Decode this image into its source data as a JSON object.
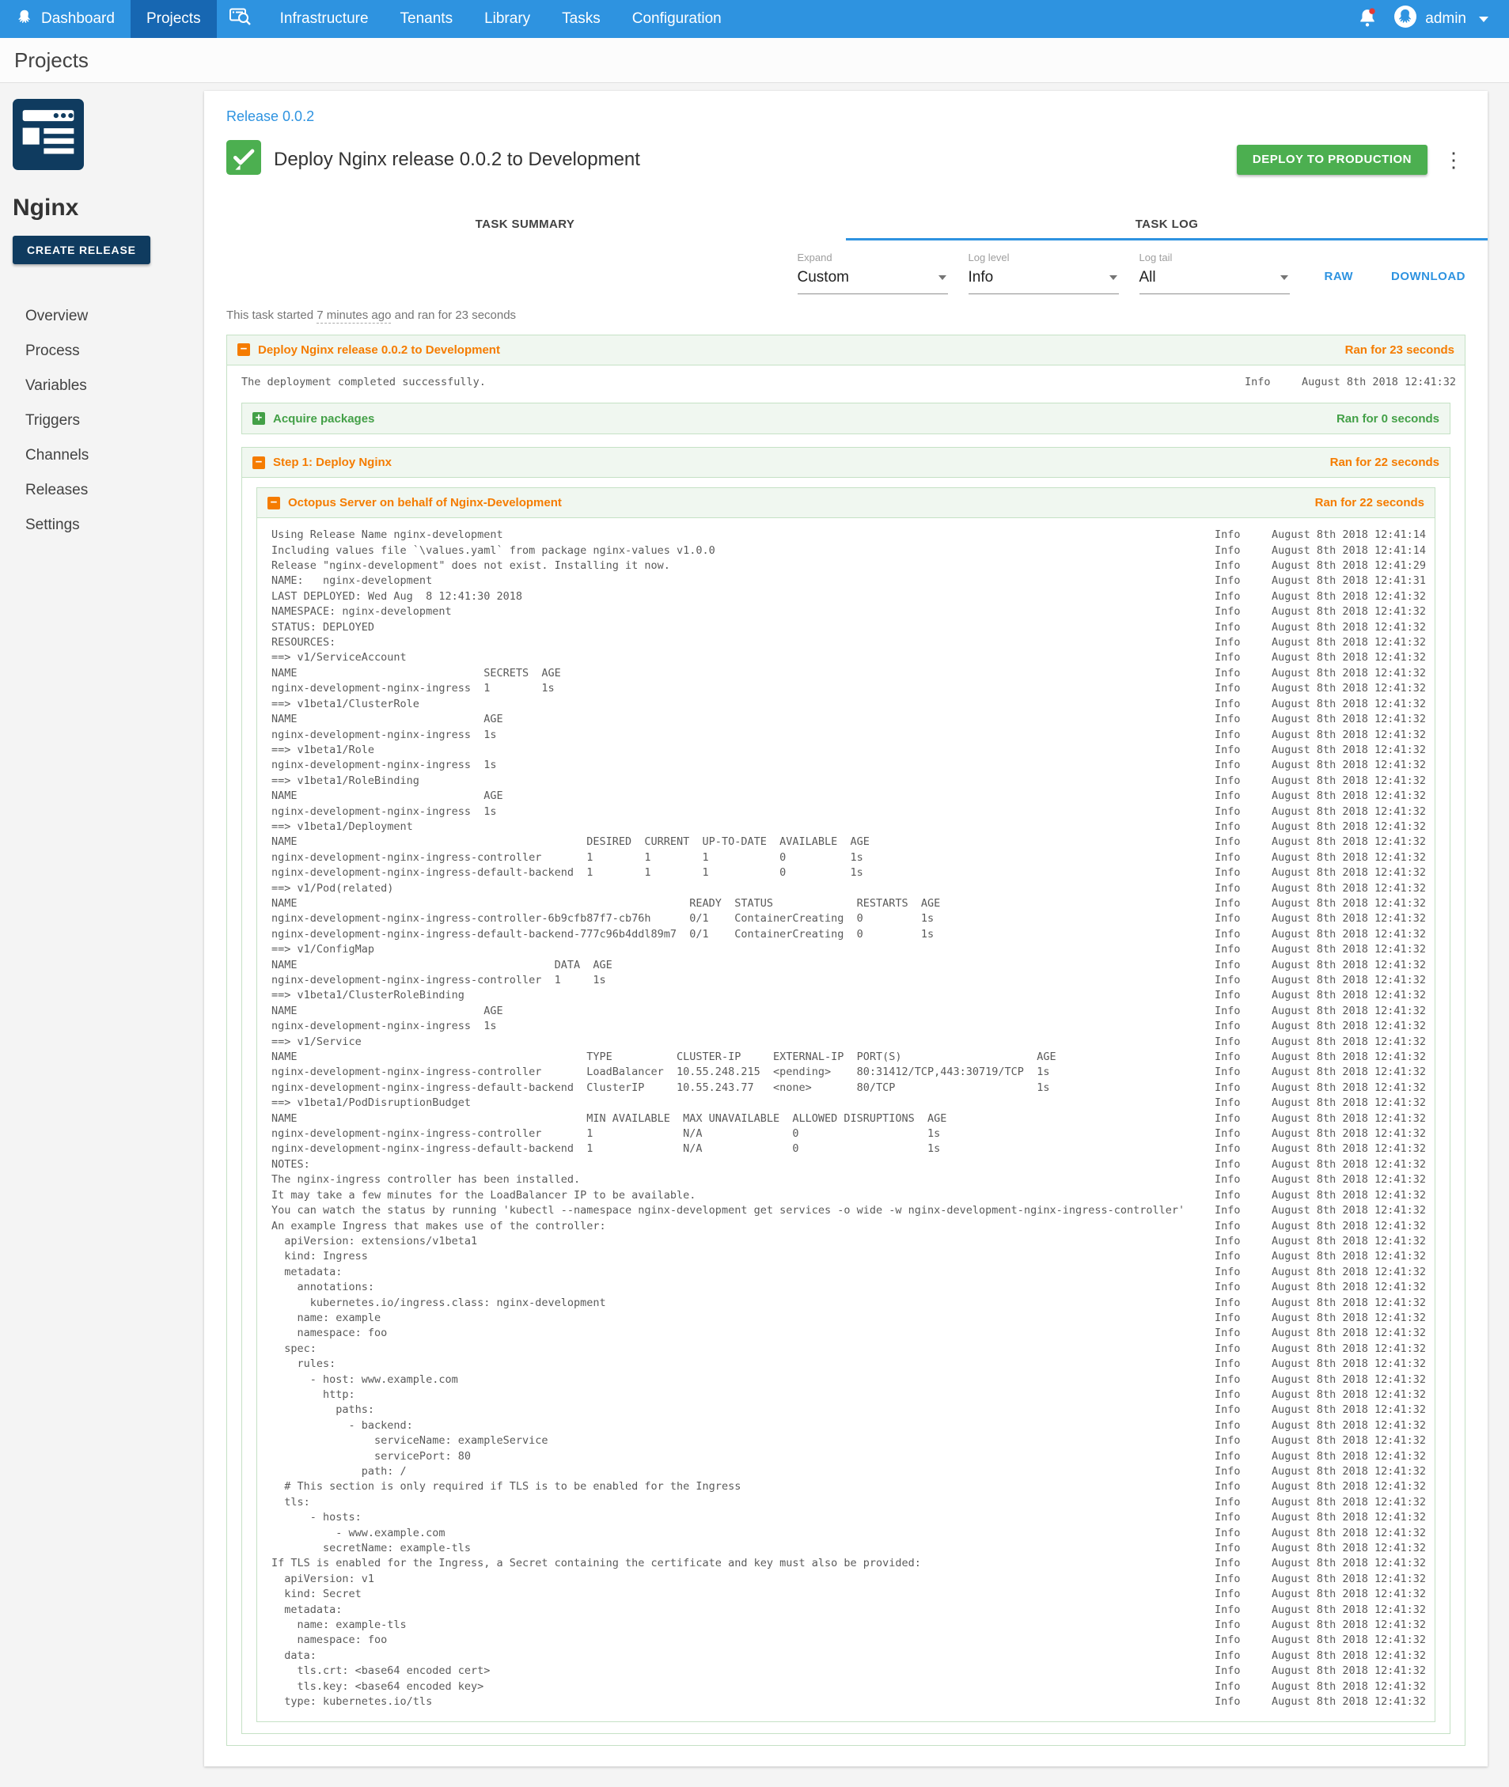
{
  "colors": {
    "nav_blue": "#2E93E0",
    "nav_active_blue": "#1767B2",
    "brand_navy": "#0F3B5F",
    "success_green": "#4CAF50",
    "section_green": "#43A047",
    "section_orange": "#F57C00",
    "box_border_green": "#C5E1C5",
    "box_header_green": "#F0F7F0",
    "link_blue": "#2E93E0",
    "alert_red": "#E53935"
  },
  "nav": {
    "items": [
      {
        "label": "Dashboard",
        "icon": "octopus-logo"
      },
      {
        "label": "Projects",
        "active": true
      },
      {
        "label": "",
        "icon": "search"
      },
      {
        "label": "Infrastructure"
      },
      {
        "label": "Tenants"
      },
      {
        "label": "Library"
      },
      {
        "label": "Tasks"
      },
      {
        "label": "Configuration"
      }
    ],
    "notifications_icon": "bell-with-red-dot",
    "user": "admin"
  },
  "page_title": "Projects",
  "sidebar": {
    "project_icon": "project-card-icon",
    "project_name": "Nginx",
    "create_release_label": "CREATE RELEASE",
    "items": [
      "Overview",
      "Process",
      "Variables",
      "Triggers",
      "Channels",
      "Releases",
      "Settings"
    ]
  },
  "task": {
    "release_link": "Release 0.0.2",
    "status_icon": "green-check",
    "title": "Deploy Nginx release 0.0.2 to Development",
    "deploy_button": "DEPLOY TO PRODUCTION",
    "tabs": {
      "summary": "TASK SUMMARY",
      "log": "TASK LOG"
    },
    "active_tab": "TASK LOG",
    "filters": {
      "expand": {
        "label": "Expand",
        "value": "Custom"
      },
      "log_level": {
        "label": "Log level",
        "value": "Info"
      },
      "log_tail": {
        "label": "Log tail",
        "value": "All"
      }
    },
    "raw_link": "RAW",
    "download_link": "DOWNLOAD",
    "meta": {
      "prefix": "This task started",
      "time_ago": "7 minutes ago",
      "suffix": "and ran for 23 seconds"
    }
  },
  "log": {
    "root": {
      "title": "Deploy Nginx release 0.0.2 to Development",
      "duration": "Ran for 23 seconds",
      "toggle_icon": "collapse-icon",
      "lines": [
        {
          "m": "The deployment completed successfully.",
          "l": "Info",
          "t": "August 8th 2018 12:41:32"
        }
      ]
    },
    "acquire": {
      "title": "Acquire packages",
      "duration": "Ran for 0 seconds",
      "toggle_icon": "expand-icon"
    },
    "step": {
      "title": "Step 1: Deploy Nginx",
      "duration": "Ran for 22 seconds",
      "toggle_icon": "collapse-icon"
    },
    "server": {
      "title": "Octopus Server on behalf of Nginx-Development",
      "duration": "Ran for 22 seconds",
      "toggle_icon": "collapse-icon",
      "lines": [
        {
          "m": "Using Release Name nginx-development",
          "l": "Info",
          "t": "August 8th 2018 12:41:14"
        },
        {
          "m": "Including values file `\\values.yaml` from package nginx-values v1.0.0",
          "l": "Info",
          "t": "August 8th 2018 12:41:14"
        },
        {
          "m": "Release \"nginx-development\" does not exist. Installing it now.",
          "l": "Info",
          "t": "August 8th 2018 12:41:29"
        },
        {
          "m": "NAME:   nginx-development",
          "l": "Info",
          "t": "August 8th 2018 12:41:31"
        },
        {
          "m": "LAST DEPLOYED: Wed Aug  8 12:41:30 2018",
          "l": "Info",
          "t": "August 8th 2018 12:41:32"
        },
        {
          "m": "NAMESPACE: nginx-development",
          "l": "Info",
          "t": "August 8th 2018 12:41:32"
        },
        {
          "m": "STATUS: DEPLOYED",
          "l": "Info",
          "t": "August 8th 2018 12:41:32"
        },
        {
          "m": "RESOURCES:",
          "l": "Info",
          "t": "August 8th 2018 12:41:32"
        },
        {
          "m": "==> v1/ServiceAccount",
          "l": "Info",
          "t": "August 8th 2018 12:41:32"
        },
        {
          "m": "NAME                             SECRETS  AGE",
          "l": "Info",
          "t": "August 8th 2018 12:41:32"
        },
        {
          "m": "nginx-development-nginx-ingress  1        1s",
          "l": "Info",
          "t": "August 8th 2018 12:41:32"
        },
        {
          "m": "==> v1beta1/ClusterRole",
          "l": "Info",
          "t": "August 8th 2018 12:41:32"
        },
        {
          "m": "NAME                             AGE",
          "l": "Info",
          "t": "August 8th 2018 12:41:32"
        },
        {
          "m": "nginx-development-nginx-ingress  1s",
          "l": "Info",
          "t": "August 8th 2018 12:41:32"
        },
        {
          "m": "==> v1beta1/Role",
          "l": "Info",
          "t": "August 8th 2018 12:41:32"
        },
        {
          "m": "nginx-development-nginx-ingress  1s",
          "l": "Info",
          "t": "August 8th 2018 12:41:32"
        },
        {
          "m": "==> v1beta1/RoleBinding",
          "l": "Info",
          "t": "August 8th 2018 12:41:32"
        },
        {
          "m": "NAME                             AGE",
          "l": "Info",
          "t": "August 8th 2018 12:41:32"
        },
        {
          "m": "nginx-development-nginx-ingress  1s",
          "l": "Info",
          "t": "August 8th 2018 12:41:32"
        },
        {
          "m": "==> v1beta1/Deployment",
          "l": "Info",
          "t": "August 8th 2018 12:41:32"
        },
        {
          "m": "NAME                                             DESIRED  CURRENT  UP-TO-DATE  AVAILABLE  AGE",
          "l": "Info",
          "t": "August 8th 2018 12:41:32"
        },
        {
          "m": "nginx-development-nginx-ingress-controller       1        1        1           0          1s",
          "l": "Info",
          "t": "August 8th 2018 12:41:32"
        },
        {
          "m": "nginx-development-nginx-ingress-default-backend  1        1        1           0          1s",
          "l": "Info",
          "t": "August 8th 2018 12:41:32"
        },
        {
          "m": "==> v1/Pod(related)",
          "l": "Info",
          "t": "August 8th 2018 12:41:32"
        },
        {
          "m": "NAME                                                             READY  STATUS             RESTARTS  AGE",
          "l": "Info",
          "t": "August 8th 2018 12:41:32"
        },
        {
          "m": "nginx-development-nginx-ingress-controller-6b9cfb87f7-cb76h      0/1    ContainerCreating  0         1s",
          "l": "Info",
          "t": "August 8th 2018 12:41:32"
        },
        {
          "m": "nginx-development-nginx-ingress-default-backend-777c96b4ddl89m7  0/1    ContainerCreating  0         1s",
          "l": "Info",
          "t": "August 8th 2018 12:41:32"
        },
        {
          "m": "==> v1/ConfigMap",
          "l": "Info",
          "t": "August 8th 2018 12:41:32"
        },
        {
          "m": "NAME                                        DATA  AGE",
          "l": "Info",
          "t": "August 8th 2018 12:41:32"
        },
        {
          "m": "nginx-development-nginx-ingress-controller  1     1s",
          "l": "Info",
          "t": "August 8th 2018 12:41:32"
        },
        {
          "m": "==> v1beta1/ClusterRoleBinding",
          "l": "Info",
          "t": "August 8th 2018 12:41:32"
        },
        {
          "m": "NAME                             AGE",
          "l": "Info",
          "t": "August 8th 2018 12:41:32"
        },
        {
          "m": "nginx-development-nginx-ingress  1s",
          "l": "Info",
          "t": "August 8th 2018 12:41:32"
        },
        {
          "m": "==> v1/Service",
          "l": "Info",
          "t": "August 8th 2018 12:41:32"
        },
        {
          "m": "NAME                                             TYPE          CLUSTER-IP     EXTERNAL-IP  PORT(S)                     AGE",
          "l": "Info",
          "t": "August 8th 2018 12:41:32"
        },
        {
          "m": "nginx-development-nginx-ingress-controller       LoadBalancer  10.55.248.215  <pending>    80:31412/TCP,443:30719/TCP  1s",
          "l": "Info",
          "t": "August 8th 2018 12:41:32"
        },
        {
          "m": "nginx-development-nginx-ingress-default-backend  ClusterIP     10.55.243.77   <none>       80/TCP                      1s",
          "l": "Info",
          "t": "August 8th 2018 12:41:32"
        },
        {
          "m": "==> v1beta1/PodDisruptionBudget",
          "l": "Info",
          "t": "August 8th 2018 12:41:32"
        },
        {
          "m": "NAME                                             MIN AVAILABLE  MAX UNAVAILABLE  ALLOWED DISRUPTIONS  AGE",
          "l": "Info",
          "t": "August 8th 2018 12:41:32"
        },
        {
          "m": "nginx-development-nginx-ingress-controller       1              N/A              0                    1s",
          "l": "Info",
          "t": "August 8th 2018 12:41:32"
        },
        {
          "m": "nginx-development-nginx-ingress-default-backend  1              N/A              0                    1s",
          "l": "Info",
          "t": "August 8th 2018 12:41:32"
        },
        {
          "m": "NOTES:",
          "l": "Info",
          "t": "August 8th 2018 12:41:32"
        },
        {
          "m": "The nginx-ingress controller has been installed.",
          "l": "Info",
          "t": "August 8th 2018 12:41:32"
        },
        {
          "m": "It may take a few minutes for the LoadBalancer IP to be available.",
          "l": "Info",
          "t": "August 8th 2018 12:41:32"
        },
        {
          "m": "You can watch the status by running 'kubectl --namespace nginx-development get services -o wide -w nginx-development-nginx-ingress-controller'",
          "l": "Info",
          "t": "August 8th 2018 12:41:32"
        },
        {
          "m": "An example Ingress that makes use of the controller:",
          "l": "Info",
          "t": "August 8th 2018 12:41:32"
        },
        {
          "m": "  apiVersion: extensions/v1beta1",
          "l": "Info",
          "t": "August 8th 2018 12:41:32"
        },
        {
          "m": "  kind: Ingress",
          "l": "Info",
          "t": "August 8th 2018 12:41:32"
        },
        {
          "m": "  metadata:",
          "l": "Info",
          "t": "August 8th 2018 12:41:32"
        },
        {
          "m": "    annotations:",
          "l": "Info",
          "t": "August 8th 2018 12:41:32"
        },
        {
          "m": "      kubernetes.io/ingress.class: nginx-development",
          "l": "Info",
          "t": "August 8th 2018 12:41:32"
        },
        {
          "m": "    name: example",
          "l": "Info",
          "t": "August 8th 2018 12:41:32"
        },
        {
          "m": "    namespace: foo",
          "l": "Info",
          "t": "August 8th 2018 12:41:32"
        },
        {
          "m": "  spec:",
          "l": "Info",
          "t": "August 8th 2018 12:41:32"
        },
        {
          "m": "    rules:",
          "l": "Info",
          "t": "August 8th 2018 12:41:32"
        },
        {
          "m": "      - host: www.example.com",
          "l": "Info",
          "t": "August 8th 2018 12:41:32"
        },
        {
          "m": "        http:",
          "l": "Info",
          "t": "August 8th 2018 12:41:32"
        },
        {
          "m": "          paths:",
          "l": "Info",
          "t": "August 8th 2018 12:41:32"
        },
        {
          "m": "            - backend:",
          "l": "Info",
          "t": "August 8th 2018 12:41:32"
        },
        {
          "m": "                serviceName: exampleService",
          "l": "Info",
          "t": "August 8th 2018 12:41:32"
        },
        {
          "m": "                servicePort: 80",
          "l": "Info",
          "t": "August 8th 2018 12:41:32"
        },
        {
          "m": "              path: /",
          "l": "Info",
          "t": "August 8th 2018 12:41:32"
        },
        {
          "m": "  # This section is only required if TLS is to be enabled for the Ingress",
          "l": "Info",
          "t": "August 8th 2018 12:41:32"
        },
        {
          "m": "  tls:",
          "l": "Info",
          "t": "August 8th 2018 12:41:32"
        },
        {
          "m": "      - hosts:",
          "l": "Info",
          "t": "August 8th 2018 12:41:32"
        },
        {
          "m": "          - www.example.com",
          "l": "Info",
          "t": "August 8th 2018 12:41:32"
        },
        {
          "m": "        secretName: example-tls",
          "l": "Info",
          "t": "August 8th 2018 12:41:32"
        },
        {
          "m": "If TLS is enabled for the Ingress, a Secret containing the certificate and key must also be provided:",
          "l": "Info",
          "t": "August 8th 2018 12:41:32"
        },
        {
          "m": "  apiVersion: v1",
          "l": "Info",
          "t": "August 8th 2018 12:41:32"
        },
        {
          "m": "  kind: Secret",
          "l": "Info",
          "t": "August 8th 2018 12:41:32"
        },
        {
          "m": "  metadata:",
          "l": "Info",
          "t": "August 8th 2018 12:41:32"
        },
        {
          "m": "    name: example-tls",
          "l": "Info",
          "t": "August 8th 2018 12:41:32"
        },
        {
          "m": "    namespace: foo",
          "l": "Info",
          "t": "August 8th 2018 12:41:32"
        },
        {
          "m": "  data:",
          "l": "Info",
          "t": "August 8th 2018 12:41:32"
        },
        {
          "m": "    tls.crt: <base64 encoded cert>",
          "l": "Info",
          "t": "August 8th 2018 12:41:32"
        },
        {
          "m": "    tls.key: <base64 encoded key>",
          "l": "Info",
          "t": "August 8th 2018 12:41:32"
        },
        {
          "m": "  type: kubernetes.io/tls",
          "l": "Info",
          "t": "August 8th 2018 12:41:32"
        }
      ]
    }
  }
}
